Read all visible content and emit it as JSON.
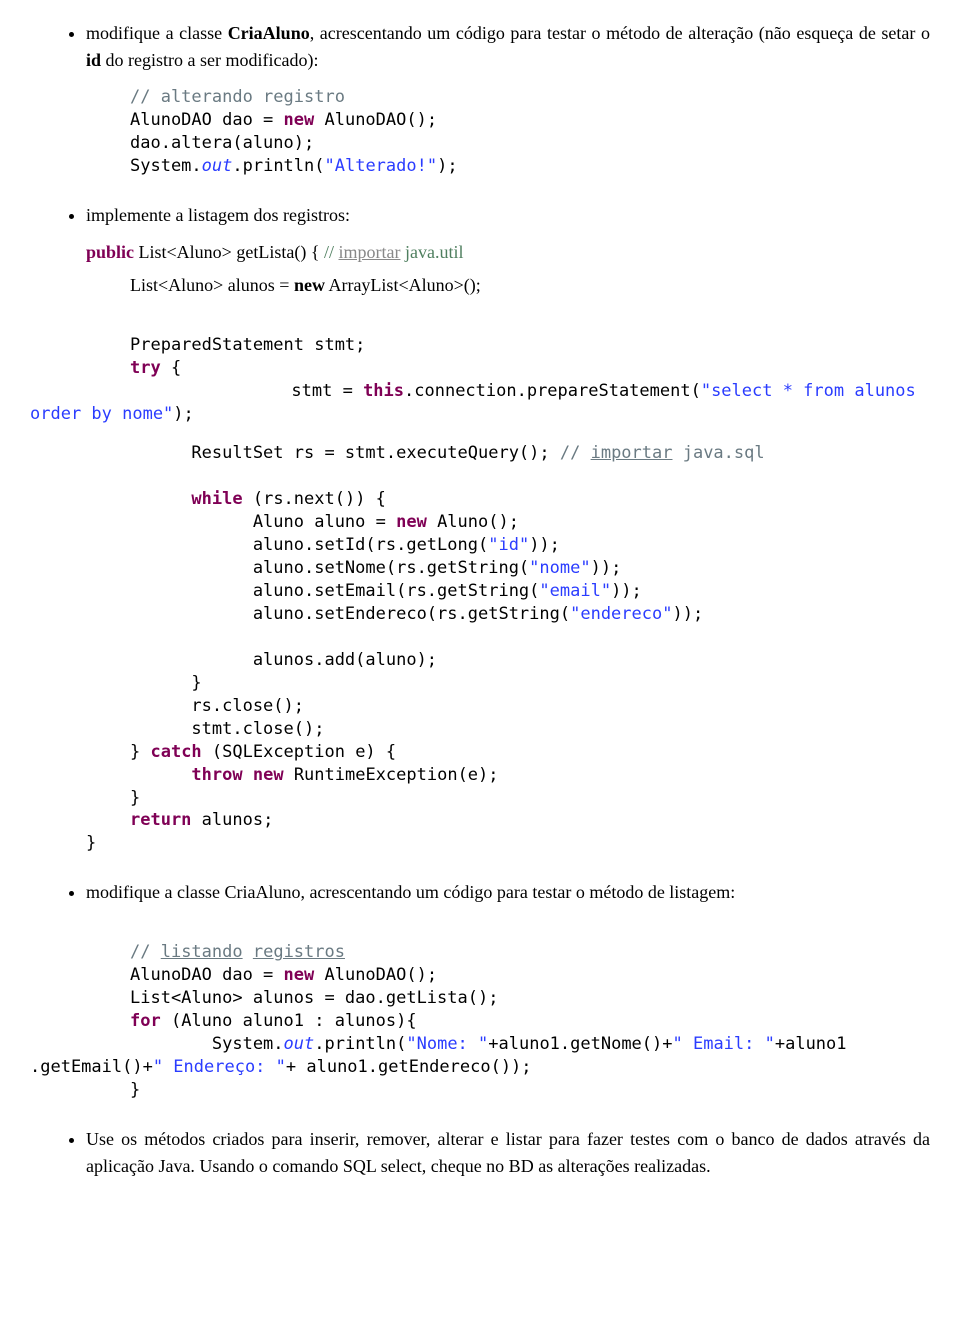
{
  "bullet1": {
    "prefix": "modifique a classe ",
    "classname": "CriaAluno",
    "mid1": ", acrescentando um código para testar o método de alteração (não esqueça de setar o ",
    "idword": "id",
    "mid2": " do registro a ser modificado):"
  },
  "code1": {
    "l1_comment": "// alterando registro",
    "l2a": "AlunoDAO dao = ",
    "l2_new": "new",
    "l2b": " AlunoDAO();",
    "l3": "dao.altera(aluno);",
    "l4a": "System.",
    "l4_out": "out",
    "l4b": ".println(",
    "l4_str": "\"Alterado!\"",
    "l4c": ");"
  },
  "bullet2": {
    "text": "implemente a listagem dos registros:"
  },
  "methodSig": {
    "public": "public",
    "sig": " List<Aluno> ",
    "name": "getLista",
    "rest": "() { ",
    "comment_prefix": "// ",
    "importar": "importar",
    "pkg": " java.util"
  },
  "methodBody": {
    "line": "List<Aluno> alunos = ",
    "new": "new",
    "rest": " ArrayList<Aluno>();"
  },
  "code2": {
    "l1": "PreparedStatement stmt;",
    "l2_try": "try",
    "l2b": " {",
    "l3a": "      stmt = ",
    "l3_this": "this",
    "l3b": ".connection.prepareStatement(",
    "l3_str": "\"select * from alunos",
    "l4_leader": "order by nome\"",
    "l4b": ");",
    "l5a": "      ResultSet rs = stmt.executeQuery(); ",
    "l5_c": "// ",
    "l5_imp": "importar",
    "l5_pkg": " java.sql",
    "l6_while": "while",
    "l6b": " (rs.next()) {",
    "l7a": "            Aluno aluno = ",
    "l7_new": "new",
    "l7b": " Aluno();",
    "l8a": "            aluno.setId(rs.getLong(",
    "l8_str": "\"id\"",
    "l8b": "));",
    "l9a": "            aluno.setNome(rs.getString(",
    "l9_str": "\"nome\"",
    "l9b": "));",
    "l10a": "            aluno.setEmail(rs.getString(",
    "l10_str": "\"email\"",
    "l10b": "));",
    "l11a": "            aluno.setEndereco(rs.getString(",
    "l11_str": "\"endereco\"",
    "l11b": "));",
    "l12": "            alunos.add(aluno);",
    "l13": "      }",
    "l14": "      rs.close();",
    "l15": "      stmt.close();",
    "l16a": "} ",
    "l16_catch": "catch",
    "l16b": " (SQLException e) {",
    "l17a": "      ",
    "l17_throw": "throw",
    "l17b": " ",
    "l17_new": "new",
    "l17c": " RuntimeException(e);",
    "l18": "}",
    "l19_ret": "return",
    "l19b": " alunos;",
    "l20": "}"
  },
  "bullet3": {
    "text": "modifique a classe CriaAluno, acrescentando um código para testar o método de listagem:"
  },
  "code3": {
    "l1a": "// ",
    "l1b": "listando",
    "l1c": " ",
    "l1d": "registros",
    "l2a": "AlunoDAO dao = ",
    "l2_new": "new",
    "l2b": " AlunoDAO();",
    "l3": "List<Aluno> alunos = dao.getLista();",
    "l4_for": "for",
    "l4b": " (Aluno aluno1 : alunos){",
    "l5a": "        System.",
    "l5_out": "out",
    "l5b": ".println(",
    "l5_str1": "\"Nome: \"",
    "l5c": "+aluno1.getNome()+",
    "l5_str2": "\" Email: \"",
    "l5d": "+aluno1",
    "l6a": ".getEmail()+",
    "l6_str": "\" Endereço: \"",
    "l6b": "+ aluno1.getEndereco());",
    "l7": "}"
  },
  "bullet4": {
    "text": "Use os métodos criados para inserir, remover, alterar e listar para fazer testes com o banco de dados através da aplicação Java. Usando o comando SQL select, cheque no BD as alterações realizadas."
  }
}
